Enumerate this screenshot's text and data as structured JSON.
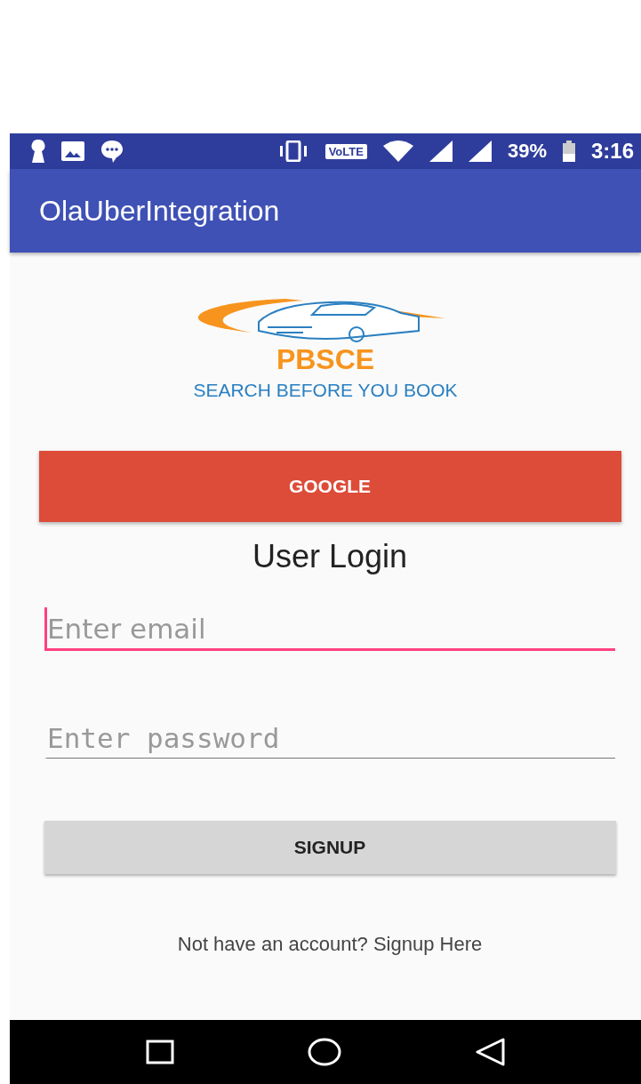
{
  "status_bar": {
    "volte": "VoLTE",
    "battery": "39%",
    "time": "3:16"
  },
  "app_bar": {
    "title": "OlaUberIntegration"
  },
  "logo": {
    "name": "PBSCE",
    "tagline": "SEARCH BEFORE YOU BOOK"
  },
  "google_button": "GOOGLE",
  "heading": "User Login",
  "fields": [
    {
      "placeholder": "Enter email",
      "focused": true,
      "kind": "email"
    },
    {
      "placeholder": "Enter password",
      "focused": false,
      "kind": "password"
    }
  ],
  "signup_button": "SIGNUP",
  "footer_link": "Not have an account? Signup Here"
}
